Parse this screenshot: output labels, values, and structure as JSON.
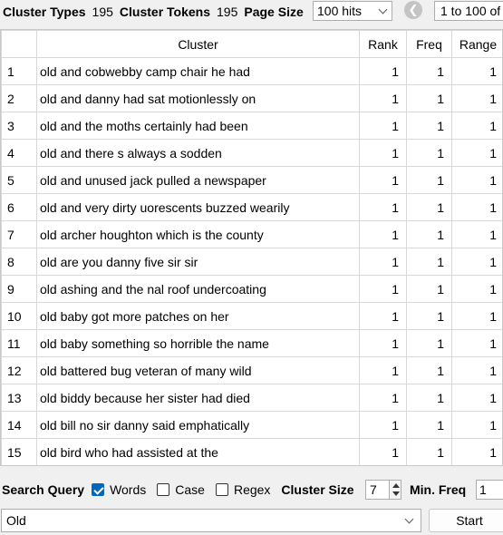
{
  "toolbar": {
    "cluster_types_label": "Cluster Types",
    "cluster_types_value": "195",
    "cluster_tokens_label": "Cluster Tokens",
    "cluster_tokens_value": "195",
    "page_size_label": "Page Size",
    "page_size_value": "100 hits",
    "range_text": "1 to 100 of"
  },
  "table": {
    "headers": [
      "Cluster",
      "Rank",
      "Freq",
      "Range"
    ],
    "rows": [
      {
        "idx": "1",
        "cluster": "old and cobwebby camp chair he had",
        "rank": "1",
        "freq": "1",
        "range": "1"
      },
      {
        "idx": "2",
        "cluster": "old and danny had sat motionlessly on",
        "rank": "1",
        "freq": "1",
        "range": "1"
      },
      {
        "idx": "3",
        "cluster": "old and the moths certainly had been",
        "rank": "1",
        "freq": "1",
        "range": "1"
      },
      {
        "idx": "4",
        "cluster": "old and there s always a sodden",
        "rank": "1",
        "freq": "1",
        "range": "1"
      },
      {
        "idx": "5",
        "cluster": "old and unused jack pulled a newspaper",
        "rank": "1",
        "freq": "1",
        "range": "1"
      },
      {
        "idx": "6",
        "cluster": "old and very dirty uorescents buzzed wearily",
        "rank": "1",
        "freq": "1",
        "range": "1"
      },
      {
        "idx": "7",
        "cluster": "old archer houghton which is the county",
        "rank": "1",
        "freq": "1",
        "range": "1"
      },
      {
        "idx": "8",
        "cluster": "old are you danny five sir sir",
        "rank": "1",
        "freq": "1",
        "range": "1"
      },
      {
        "idx": "9",
        "cluster": "old ashing and the nal roof undercoating",
        "rank": "1",
        "freq": "1",
        "range": "1"
      },
      {
        "idx": "10",
        "cluster": "old baby got more patches on her",
        "rank": "1",
        "freq": "1",
        "range": "1"
      },
      {
        "idx": "11",
        "cluster": "old baby something so horrible the name",
        "rank": "1",
        "freq": "1",
        "range": "1"
      },
      {
        "idx": "12",
        "cluster": "old battered bug veteran of many wild",
        "rank": "1",
        "freq": "1",
        "range": "1"
      },
      {
        "idx": "13",
        "cluster": "old biddy because her sister had died",
        "rank": "1",
        "freq": "1",
        "range": "1"
      },
      {
        "idx": "14",
        "cluster": "old bill no sir danny said emphatically",
        "rank": "1",
        "freq": "1",
        "range": "1"
      },
      {
        "idx": "15",
        "cluster": "old bird who had assisted at the",
        "rank": "1",
        "freq": "1",
        "range": "1"
      },
      {
        "idx": "",
        "cluster": "",
        "rank": "",
        "freq": "",
        "range": ""
      }
    ]
  },
  "search": {
    "label": "Search Query",
    "words_label": "Words",
    "words_checked": true,
    "case_label": "Case",
    "case_checked": false,
    "regex_label": "Regex",
    "regex_checked": false,
    "cluster_size_label": "Cluster Size",
    "cluster_size_value": "7",
    "min_freq_label": "Min. Freq",
    "min_freq_value": "1",
    "query_value": "Old",
    "start_label": "Start"
  },
  "icons": {
    "prev_page": "arrow-left-circle-icon",
    "dropdown": "chevron-down-icon"
  },
  "colors": {
    "checkbox_accent": "#0067c0"
  }
}
